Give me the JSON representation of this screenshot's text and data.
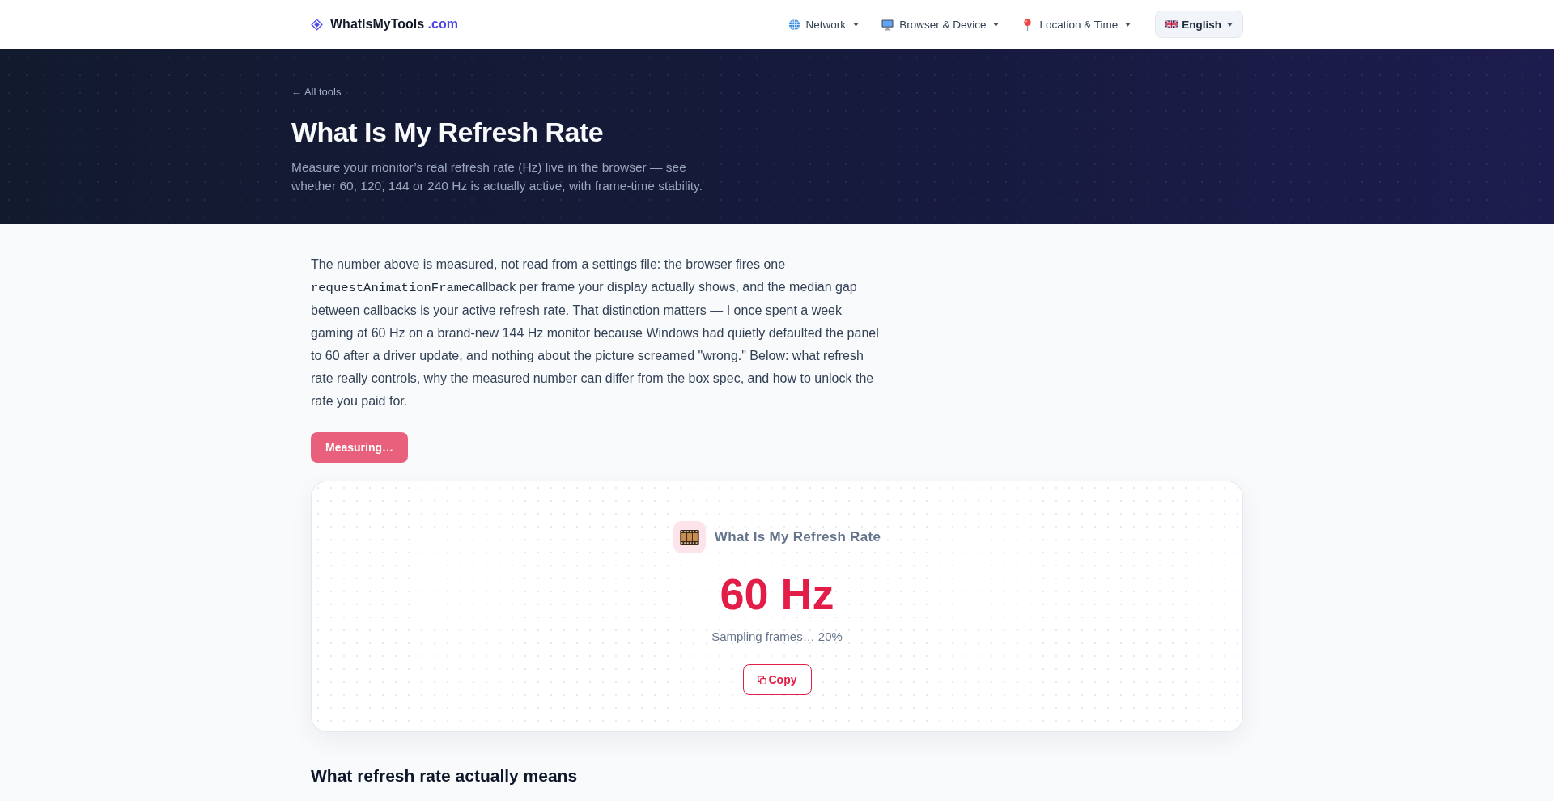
{
  "header": {
    "logo": {
      "name": "WhatIsMyTools",
      "suffix": ".com"
    },
    "nav": [
      {
        "label": "Network"
      },
      {
        "label": "Browser & Device"
      },
      {
        "label": "Location & Time"
      }
    ],
    "language": {
      "label": "English"
    }
  },
  "hero": {
    "back_link": "← All tools",
    "title": "What Is My Refresh Rate",
    "subtitle": "Measure your monitor’s real refresh rate (Hz) live in the browser — see whether 60, 120, 144 or 240 Hz is actually active, with frame-time stability."
  },
  "intro": {
    "parts": [
      {
        "kind": "text",
        "text": "The number above is measured, not read from a settings file: the browser fires one "
      },
      {
        "kind": "code",
        "text": "requestAnimationFrame"
      },
      {
        "kind": "text",
        "text": "callback per frame your display actually shows, and the median gap between callbacks is your active refresh rate. That distinction matters — I once spent a week gaming at 60 Hz on a brand-new 144 Hz monitor because Windows had quietly defaulted the panel to 60 after a driver update, and nothing about the picture screamed \"wrong.\" Below: what refresh rate really controls, why the measured number can differ from the box spec, and how to unlock the rate you paid for."
      }
    ]
  },
  "measure_button": {
    "label": "Measuring…",
    "disabled": true
  },
  "result_card": {
    "title": "What Is My Refresh Rate",
    "value": "60 Hz",
    "status": "Sampling frames… 20%",
    "copy_button": "Copy"
  },
  "section_heading": "What refresh rate actually means"
}
